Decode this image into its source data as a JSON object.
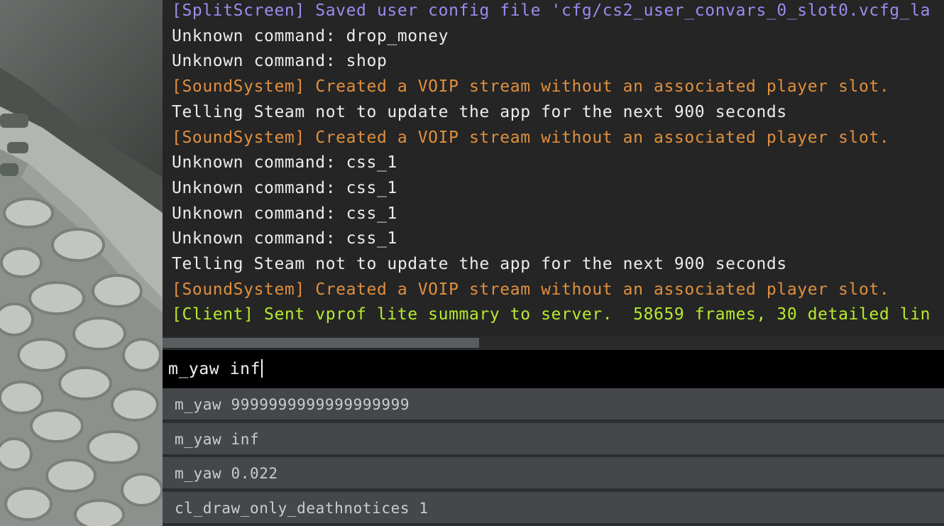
{
  "console": {
    "log": [
      {
        "text": "[SplitScreen] Saved user config file 'cfg/cs2_user_convars_0_slot0.vcfg_la",
        "color": "purple"
      },
      {
        "text": "Unknown command: drop_money",
        "color": "white"
      },
      {
        "text": "Unknown command: shop",
        "color": "white"
      },
      {
        "text": "[SoundSystem] Created a VOIP stream without an associated player slot.",
        "color": "orange"
      },
      {
        "text": "Telling Steam not to update the app for the next 900 seconds",
        "color": "white"
      },
      {
        "text": "[SoundSystem] Created a VOIP stream without an associated player slot.",
        "color": "orange"
      },
      {
        "text": "Unknown command: css_1",
        "color": "white"
      },
      {
        "text": "Unknown command: css_1",
        "color": "white"
      },
      {
        "text": "Unknown command: css_1",
        "color": "white"
      },
      {
        "text": "Unknown command: css_1",
        "color": "white"
      },
      {
        "text": "Telling Steam not to update the app for the next 900 seconds",
        "color": "white"
      },
      {
        "text": "[SoundSystem] Created a VOIP stream without an associated player slot.",
        "color": "orange"
      },
      {
        "text": "[Client] Sent vprof lite summary to server.  58659 frames, 30 detailed lin",
        "color": "green"
      }
    ],
    "input": {
      "value": "m_yaw inf"
    },
    "suggestions": [
      {
        "label": "m_yaw 9999999999999999999"
      },
      {
        "label": "m_yaw inf"
      },
      {
        "label": "m_yaw 0.022"
      },
      {
        "label": "cl_draw_only_deathnotices 1"
      }
    ]
  },
  "colors": {
    "white": "#ececec",
    "purple": "#9b8cf0",
    "orange": "#e08f3e",
    "green": "#b8ea2e",
    "console_bg": "#252525",
    "input_bg": "#000000",
    "suggestion_bg": "#44484a"
  }
}
